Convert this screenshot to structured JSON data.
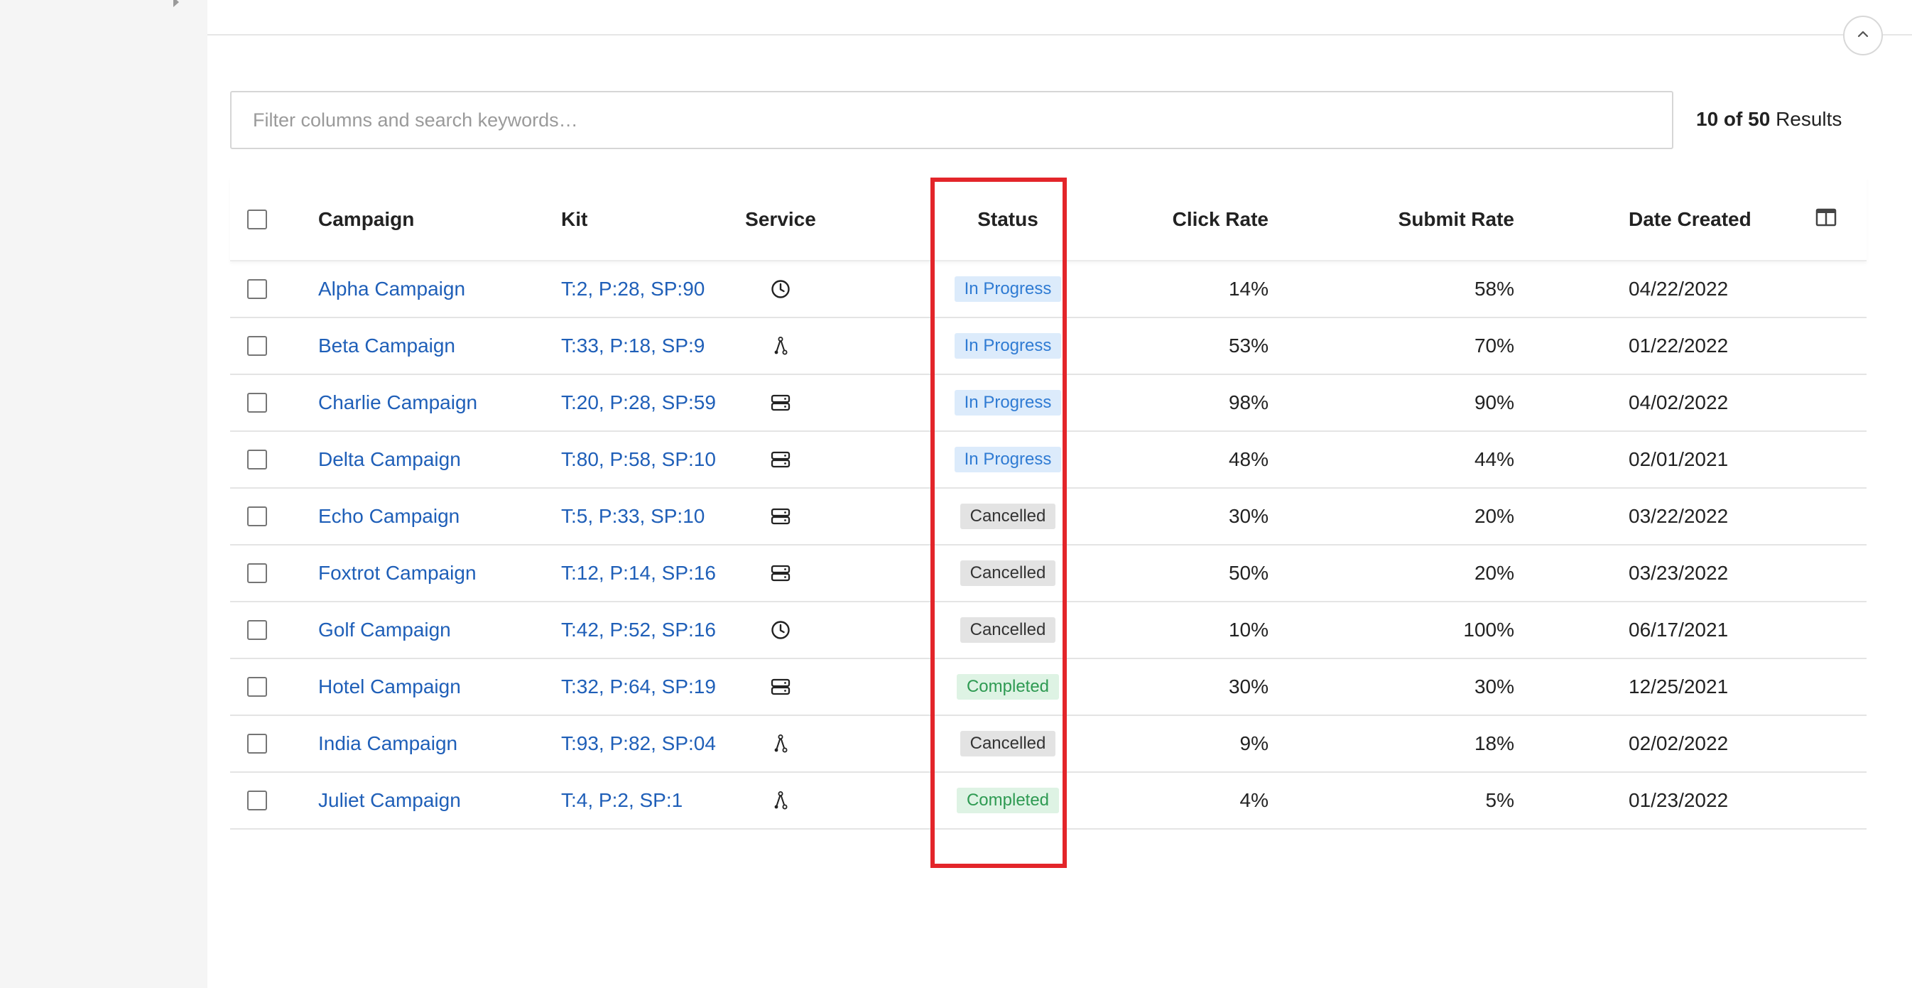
{
  "search": {
    "placeholder": "Filter columns and search keywords…",
    "value": ""
  },
  "results": {
    "count": "10 of 50",
    "suffix": "Results"
  },
  "columns": {
    "campaign": "Campaign",
    "kit": "Kit",
    "service": "Service",
    "status": "Status",
    "click_rate": "Click Rate",
    "submit_rate": "Submit Rate",
    "date_created": "Date Created"
  },
  "icons": {
    "sidebar_toggle": "caret-right-icon",
    "collapse": "chevron-up-icon",
    "column_settings": "columns-icon",
    "services": {
      "clock": "clock-icon",
      "branch": "branch-icon",
      "server": "server-icon"
    }
  },
  "colors": {
    "link": "#1f5fb8",
    "in_progress_bg": "#dcebfb",
    "in_progress_text": "#2f7bd3",
    "cancelled_bg": "#e3e3e3",
    "completed_bg": "#def3e4",
    "completed_text": "#2e9a52",
    "highlight": "#e3252a"
  },
  "rows": [
    {
      "campaign": "Alpha Campaign",
      "kit": "T:2, P:28, SP:90",
      "service": "clock",
      "status": "In Progress",
      "status_type": "progress",
      "click_rate": "14%",
      "submit_rate": "58%",
      "date_created": "04/22/2022"
    },
    {
      "campaign": "Beta Campaign",
      "kit": "T:33, P:18, SP:9",
      "service": "branch",
      "status": "In Progress",
      "status_type": "progress",
      "click_rate": "53%",
      "submit_rate": "70%",
      "date_created": "01/22/2022"
    },
    {
      "campaign": "Charlie Campaign",
      "kit": "T:20, P:28, SP:59",
      "service": "server",
      "status": "In Progress",
      "status_type": "progress",
      "click_rate": "98%",
      "submit_rate": "90%",
      "date_created": "04/02/2022"
    },
    {
      "campaign": "Delta Campaign",
      "kit": "T:80, P:58, SP:10",
      "service": "server",
      "status": "In Progress",
      "status_type": "progress",
      "click_rate": "48%",
      "submit_rate": "44%",
      "date_created": "02/01/2021"
    },
    {
      "campaign": "Echo Campaign",
      "kit": "T:5, P:33, SP:10",
      "service": "server",
      "status": "Cancelled",
      "status_type": "cancelled",
      "click_rate": "30%",
      "submit_rate": "20%",
      "date_created": "03/22/2022"
    },
    {
      "campaign": "Foxtrot Campaign",
      "kit": "T:12, P:14, SP:16",
      "service": "server",
      "status": "Cancelled",
      "status_type": "cancelled",
      "click_rate": "50%",
      "submit_rate": "20%",
      "date_created": "03/23/2022"
    },
    {
      "campaign": "Golf Campaign",
      "kit": "T:42, P:52, SP:16",
      "service": "clock",
      "status": "Cancelled",
      "status_type": "cancelled",
      "click_rate": "10%",
      "submit_rate": "100%",
      "date_created": "06/17/2021"
    },
    {
      "campaign": "Hotel Campaign",
      "kit": "T:32, P:64, SP:19",
      "service": "server",
      "status": "Completed",
      "status_type": "completed",
      "click_rate": "30%",
      "submit_rate": "30%",
      "date_created": "12/25/2021"
    },
    {
      "campaign": "India Campaign",
      "kit": "T:93, P:82, SP:04",
      "service": "branch",
      "status": "Cancelled",
      "status_type": "cancelled",
      "click_rate": "9%",
      "submit_rate": "18%",
      "date_created": "02/02/2022"
    },
    {
      "campaign": "Juliet Campaign",
      "kit": "T:4, P:2, SP:1",
      "service": "branch",
      "status": "Completed",
      "status_type": "completed",
      "click_rate": "4%",
      "submit_rate": "5%",
      "date_created": "01/23/2022"
    }
  ]
}
